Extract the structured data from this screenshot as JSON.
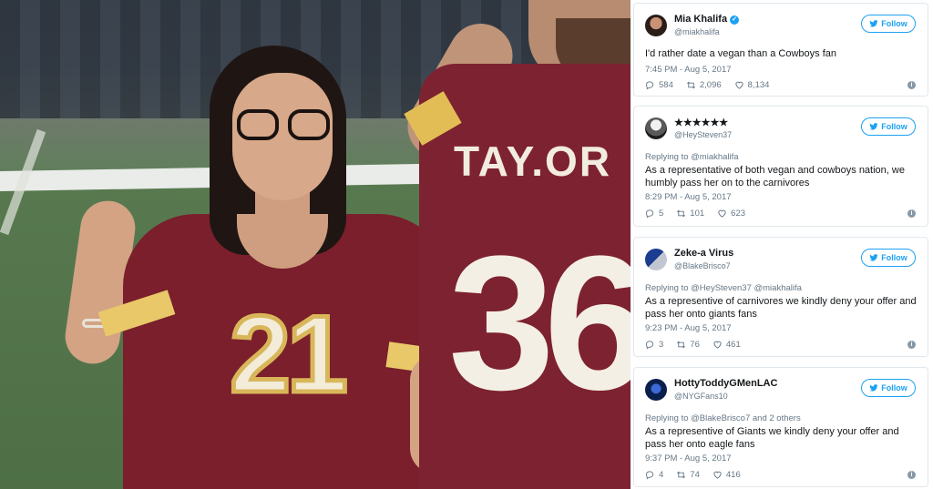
{
  "tweets": [
    {
      "name": "Mia Khalifa",
      "verified": true,
      "handle": "@miakhalifa",
      "replying": "",
      "text": "I'd rather date a vegan than a Cowboys fan",
      "time": "7:45 PM - Aug 5, 2017",
      "replies": "584",
      "retweets": "2,096",
      "likes": "8,134",
      "follow_label": "Follow"
    },
    {
      "name": "★★★★★★",
      "verified": false,
      "handle": "@HeySteven37",
      "replying": "Replying to @miakhalifa",
      "text": "As a representative of both vegan and cowboys nation, we humbly pass her on to the carnivores",
      "time": "8:29 PM - Aug 5, 2017",
      "replies": "5",
      "retweets": "101",
      "likes": "623",
      "follow_label": "Follow"
    },
    {
      "name": "Zeke-a Virus",
      "verified": false,
      "handle": "@BlakeBrisco7",
      "replying": "Replying to @HeySteven37 @miakhalifa",
      "text": "As a representive of carnivores we kindly deny your offer and pass her onto giants fans",
      "time": "9:23 PM - Aug 5, 2017",
      "replies": "3",
      "retweets": "76",
      "likes": "461",
      "follow_label": "Follow"
    },
    {
      "name": "HottyToddyGMenLAC",
      "verified": false,
      "handle": "@NYGFans10",
      "replying": "Replying to @BlakeBrisco7 and 2 others",
      "text": "As a representive of Giants we kindly deny your offer and pass her onto eagle fans",
      "time": "9:37 PM - Aug 5, 2017",
      "replies": "4",
      "retweets": "74",
      "likes": "416",
      "follow_label": "Follow"
    }
  ],
  "photo": {
    "jersey_number_left": "21",
    "jersey_name_right": "TAY.OR",
    "jersey_number_right": "36"
  },
  "colors": {
    "twitter_blue": "#1da1f2",
    "jersey_burgundy": "#7a1f2b",
    "jersey_gold": "#e9c86a"
  }
}
